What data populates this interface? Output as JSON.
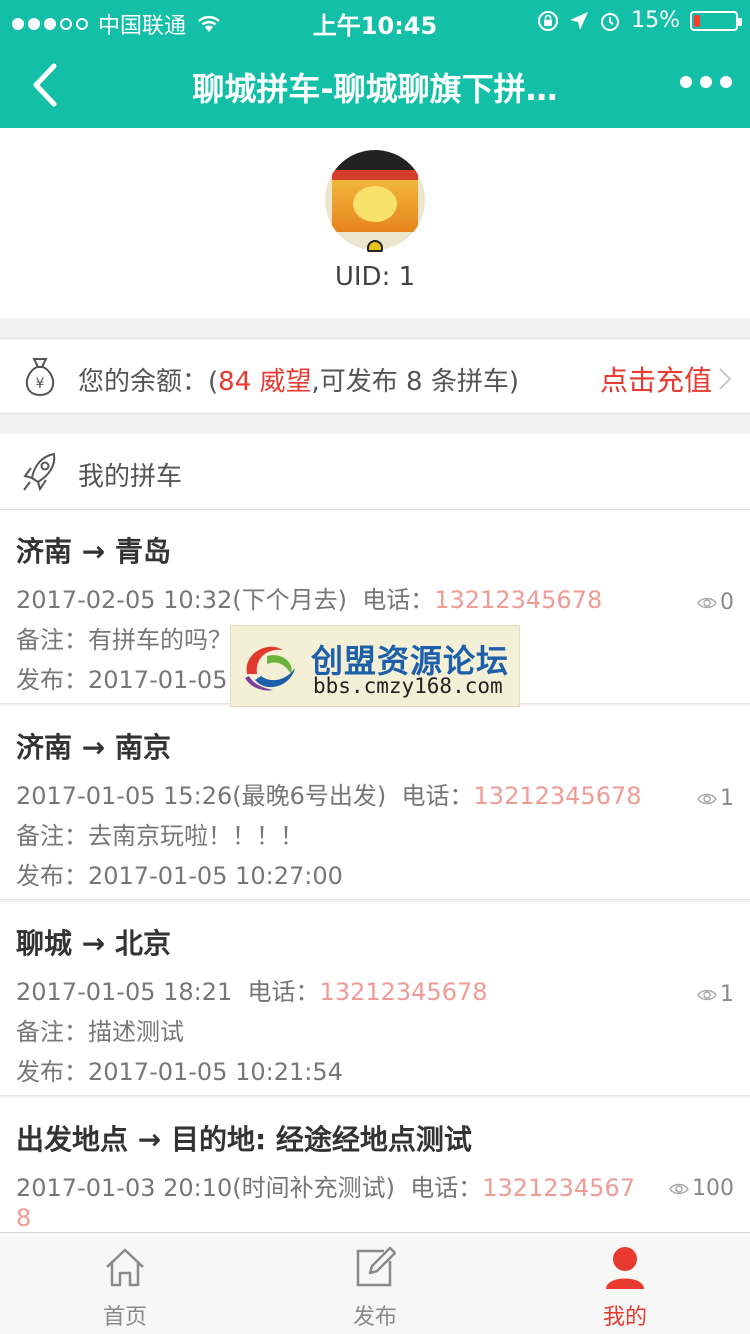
{
  "status_bar": {
    "carrier": "中国联通",
    "time": "上午10:45",
    "battery_text": "15%",
    "battery_level": 0.15
  },
  "header": {
    "back_icon": "chevron-left-icon",
    "title": "聊城拼车-聊城聊旗下拼…",
    "more_icon": "more-dots-icon",
    "bg_color": "#13bfa7"
  },
  "profile": {
    "uid_label": "UID: 1"
  },
  "balance": {
    "prefix": "您的余额：(",
    "amount": "84 威望",
    "suffix": ",可发布 8 条拼车)",
    "recharge_label": "点击充值",
    "accent_color": "#e93a2f"
  },
  "my_carpool": {
    "label": "我的拼车"
  },
  "trips": [
    {
      "route": "济南 → 青岛",
      "datetime": "2017-02-05 10:32(下个月去)",
      "phone_label": "电话：",
      "phone": "13212345678",
      "note": "备注：有拼车的吗？联系我",
      "published": "发布：2017-01-05 10:27:00",
      "views": "0"
    },
    {
      "route": "济南 → 南京",
      "datetime": "2017-01-05 15:26(最晚6号出发)",
      "phone_label": "电话：",
      "phone": "13212345678",
      "note": "备注：去南京玩啦！！！！",
      "published": "发布：2017-01-05 10:27:00",
      "views": "1"
    },
    {
      "route": "聊城 → 北京",
      "datetime": "2017-01-05 18:21",
      "phone_label": "电话：",
      "phone": "13212345678",
      "note": "备注：描述测试",
      "published": "发布：2017-01-05 10:21:54",
      "views": "1"
    },
    {
      "route": "出发地点 → 目的地: 经途经地点测试",
      "datetime": "2017-01-03 20:10(时间补充测试)",
      "phone_label": "电话：",
      "phone": "1321234567",
      "phone_wrap": "8",
      "views": "100"
    }
  ],
  "watermark": {
    "title": "创盟资源论坛",
    "url": "bbs.cmzy168.com"
  },
  "tabbar": {
    "tabs": [
      {
        "label": "首页",
        "icon": "home-icon"
      },
      {
        "label": "发布",
        "icon": "edit-icon"
      },
      {
        "label": "我的",
        "icon": "user-icon",
        "active": true
      }
    ]
  }
}
